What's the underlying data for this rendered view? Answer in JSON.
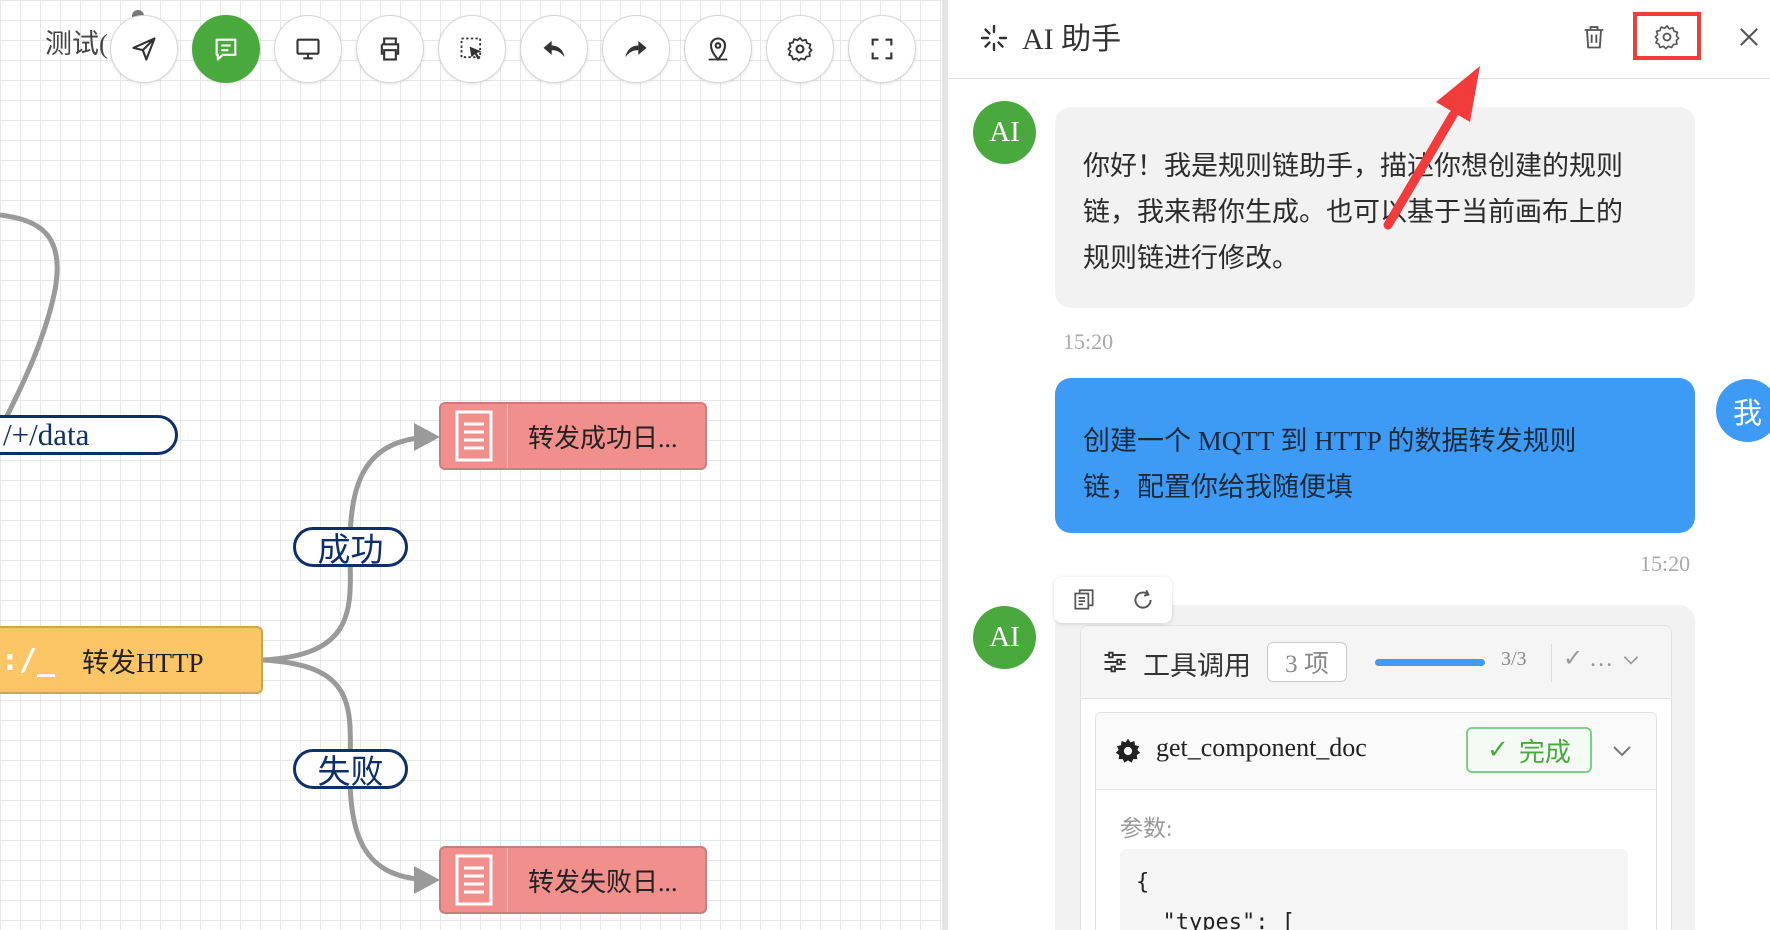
{
  "canvas": {
    "title": "测试(",
    "toolbar": [
      {
        "name": "send-icon"
      },
      {
        "name": "chat-icon",
        "active": true
      },
      {
        "name": "monitor-icon"
      },
      {
        "name": "print-icon"
      },
      {
        "name": "select-icon"
      },
      {
        "name": "undo-icon"
      },
      {
        "name": "redo-icon"
      },
      {
        "name": "location-icon"
      },
      {
        "name": "settings-icon"
      },
      {
        "name": "fullscreen-icon"
      }
    ],
    "topic_label": "/+/data",
    "node_http": {
      "icon": ":/_",
      "label": "转发HTTP"
    },
    "edge_success": "成功",
    "edge_fail": "失败",
    "node_success_log": "转发成功日...",
    "node_fail_log": "转发失败日...",
    "colors": {
      "active": "#4aa93c",
      "log_node": "#f08f8b",
      "http_node": "#fcc565",
      "edge_label": "#0e2f6a"
    }
  },
  "assistant": {
    "title": "AI 助手",
    "header_icons": [
      "sparkle-icon",
      "trash-icon",
      "gear-icon",
      "close-icon"
    ],
    "messages": [
      {
        "role": "ai",
        "avatar": "AI",
        "lines": [
          "你好！我是规则链助手，描述你想创建的规则",
          "链，我来帮你生成。也可以基于当前画布上的",
          "规则链进行修改。"
        ],
        "time": "15:20"
      },
      {
        "role": "user",
        "avatar": "我",
        "lines": [
          "创建一个 MQTT 到 HTTP 的数据转发规则",
          "链，配置你给我随便填"
        ],
        "time": "15:20"
      }
    ],
    "reply": {
      "avatar": "AI",
      "actions": [
        "copy-icon",
        "refresh-icon"
      ],
      "tools_label": "工具调用",
      "tools_count": "3 项",
      "progress_text": "3/3",
      "progress": 1.0,
      "collapse_text": "✓ …",
      "tool_call": {
        "name": "get_component_doc",
        "status": "完成",
        "params_label": "参数:",
        "code_lines": [
          "{",
          "  \"types\": ["
        ]
      }
    },
    "colors": {
      "ai_avatar": "#4aa93c",
      "user_bubble": "#3d9bf5",
      "highlight": "#f23b3b"
    }
  }
}
